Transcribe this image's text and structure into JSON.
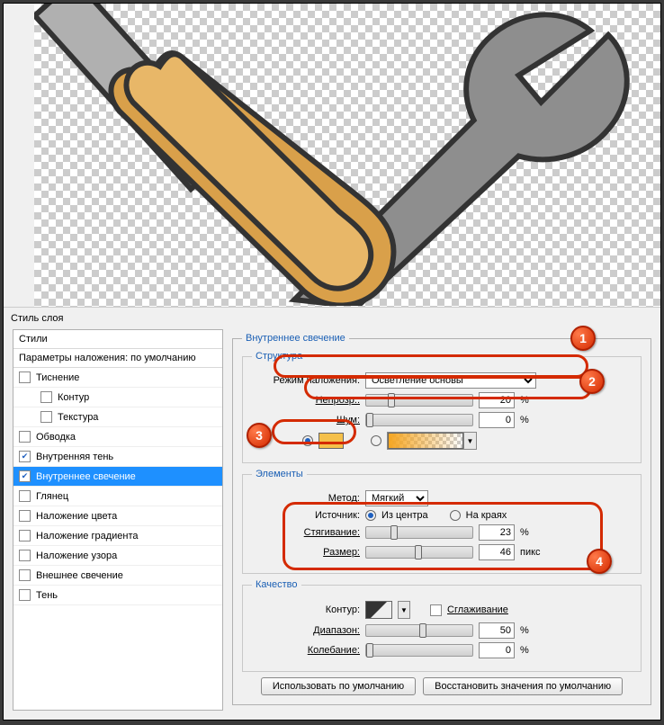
{
  "dialog_title": "Стиль слоя",
  "styles_header": "Стили",
  "blending_header": "Параметры наложения: по умолчанию",
  "effects": [
    {
      "label": "Тиснение",
      "checked": false,
      "indent": false
    },
    {
      "label": "Контур",
      "checked": false,
      "indent": true
    },
    {
      "label": "Текстура",
      "checked": false,
      "indent": true
    },
    {
      "label": "Обводка",
      "checked": false,
      "indent": false
    },
    {
      "label": "Внутренняя тень",
      "checked": true,
      "indent": false
    },
    {
      "label": "Внутреннее свечение",
      "checked": true,
      "indent": false,
      "selected": true
    },
    {
      "label": "Глянец",
      "checked": false,
      "indent": false
    },
    {
      "label": "Наложение цвета",
      "checked": false,
      "indent": false
    },
    {
      "label": "Наложение градиента",
      "checked": false,
      "indent": false
    },
    {
      "label": "Наложение узора",
      "checked": false,
      "indent": false
    },
    {
      "label": "Внешнее свечение",
      "checked": false,
      "indent": false
    },
    {
      "label": "Тень",
      "checked": false,
      "indent": false
    }
  ],
  "panel_title": "Внутреннее свечение",
  "groups": {
    "structure": "Структура",
    "elements": "Элементы",
    "quality": "Качество"
  },
  "structure": {
    "blend_label": "Режим наложения:",
    "blend_value": "Осветление основы",
    "opacity_label": "Непрозр.:",
    "opacity_value": "20",
    "noise_label": "Шум:",
    "noise_value": "0",
    "pct": "%",
    "color_hex": "#f5c04a"
  },
  "elements": {
    "method_label": "Метод:",
    "method_value": "Мягкий",
    "source_label": "Источник:",
    "source_center": "Из центра",
    "source_edge": "На краях",
    "choke_label": "Стягивание:",
    "choke_value": "23",
    "size_label": "Размер:",
    "size_value": "46",
    "pct": "%",
    "px": "пикс"
  },
  "quality": {
    "contour_label": "Контур:",
    "aa_label": "Сглаживание",
    "range_label": "Диапазон:",
    "range_value": "50",
    "jitter_label": "Колебание:",
    "jitter_value": "0",
    "pct": "%"
  },
  "buttons": {
    "default": "Использовать по умолчанию",
    "reset": "Восстановить значения по умолчанию"
  },
  "markers": {
    "m1": "1",
    "m2": "2",
    "m3": "3",
    "m4": "4"
  }
}
